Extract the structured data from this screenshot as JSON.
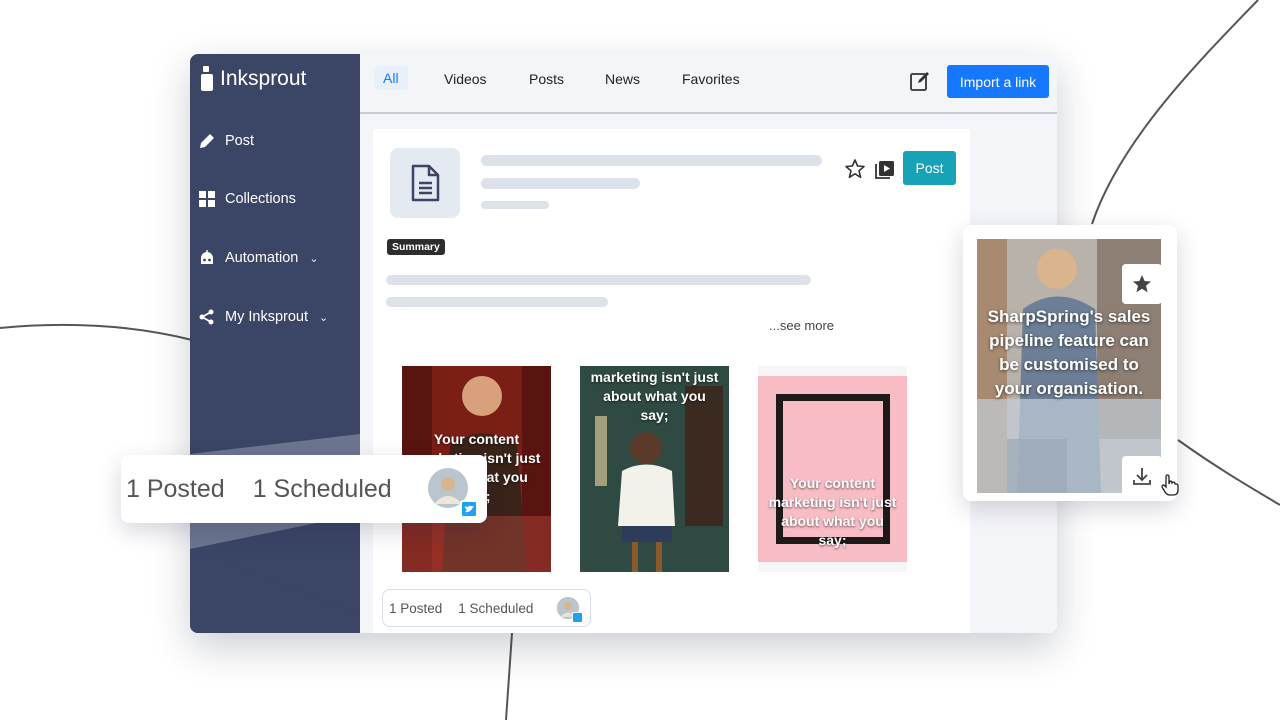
{
  "app": {
    "name": "Inksprout"
  },
  "sidebar": {
    "items": [
      {
        "label": "Post",
        "icon": "pencil-icon"
      },
      {
        "label": "Collections",
        "icon": "grid-icon"
      },
      {
        "label": "Automation",
        "icon": "robot-icon",
        "expandable": true
      },
      {
        "label": "My Inksprout",
        "icon": "share-icon",
        "expandable": true
      }
    ]
  },
  "tabs": [
    {
      "label": "All",
      "active": true
    },
    {
      "label": "Videos",
      "active": false
    },
    {
      "label": "Posts",
      "active": false
    },
    {
      "label": "News",
      "active": false
    },
    {
      "label": "Favorites",
      "active": false
    }
  ],
  "toolbar": {
    "import_label": "Import a link",
    "edit_icon": "edit-icon"
  },
  "content_card": {
    "summary_badge": "Summary",
    "see_more": "...see more",
    "post_button": "Post",
    "thumbnails": [
      {
        "caption": "Your content marketing isn't just about what you say;"
      },
      {
        "caption": "marketing isn't just about what you say;"
      },
      {
        "caption": "Your content marketing isn't just about what you say;"
      }
    ],
    "status": {
      "posted": "1 Posted",
      "scheduled": "1 Scheduled"
    }
  },
  "popup_status": {
    "posted": "1 Posted",
    "scheduled": "1 Scheduled"
  },
  "side_card": {
    "caption": "SharpSpring's sales pipeline feature can be customised to your organisation."
  },
  "colors": {
    "sidebar": "#3b4566",
    "primary": "#1677ff",
    "post": "#17a2b8",
    "twitter": "#1da1f2"
  }
}
